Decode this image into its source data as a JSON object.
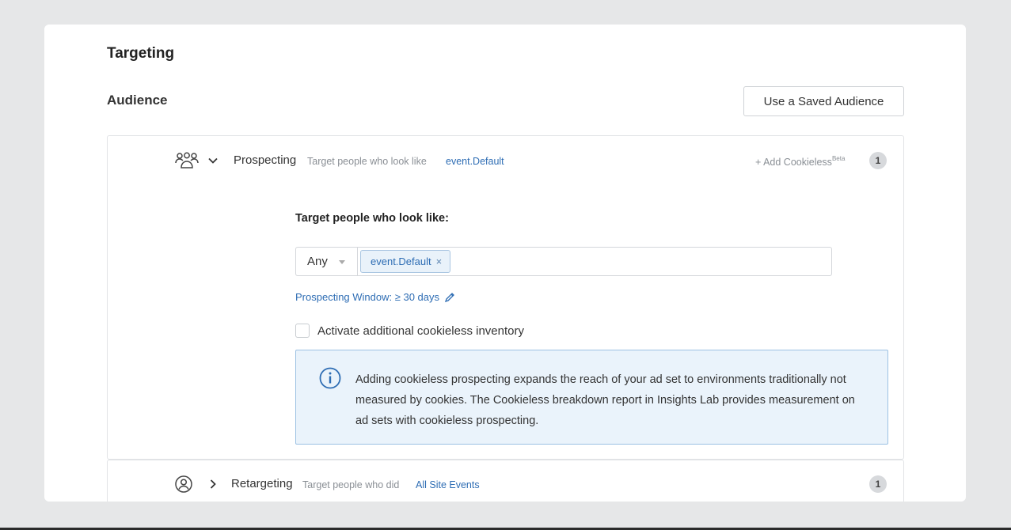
{
  "page": {
    "title": "Targeting"
  },
  "audience": {
    "title": "Audience",
    "saved_button_label": "Use a Saved Audience"
  },
  "prospecting": {
    "title": "Prospecting",
    "subtitle": "Target people who look like",
    "link": "event.Default",
    "add_cookieless": "+ Add Cookieless",
    "add_cookieless_sup": "Beta",
    "count": "1",
    "lookalike_label": "Target people who look like:",
    "match_select": "Any",
    "tag_value": "event.Default",
    "tag_remove": "×",
    "window_link": "Prospecting Window: ≥ 30 days",
    "checkbox_label": "Activate additional cookieless inventory",
    "info_text": "Adding cookieless prospecting expands the reach of your ad set to environments traditionally not measured by cookies. The Cookieless breakdown report in Insights Lab provides measurement on ad sets with cookieless prospecting."
  },
  "retargeting": {
    "title": "Retargeting",
    "subtitle": "Target people who did",
    "link": "All Site Events",
    "count": "1"
  },
  "colors": {
    "link_blue": "#2e6db4",
    "info_bg": "#eaf3fb",
    "info_border": "#9cc1e3",
    "badge_bg": "#d7d9dc"
  },
  "icons": {
    "prospecting": "people-group-icon",
    "retargeting": "person-circle-icon",
    "expanded": "chevron-down-icon",
    "collapsed": "chevron-right-icon",
    "edit": "pencil-icon",
    "info": "info-circle-icon"
  }
}
